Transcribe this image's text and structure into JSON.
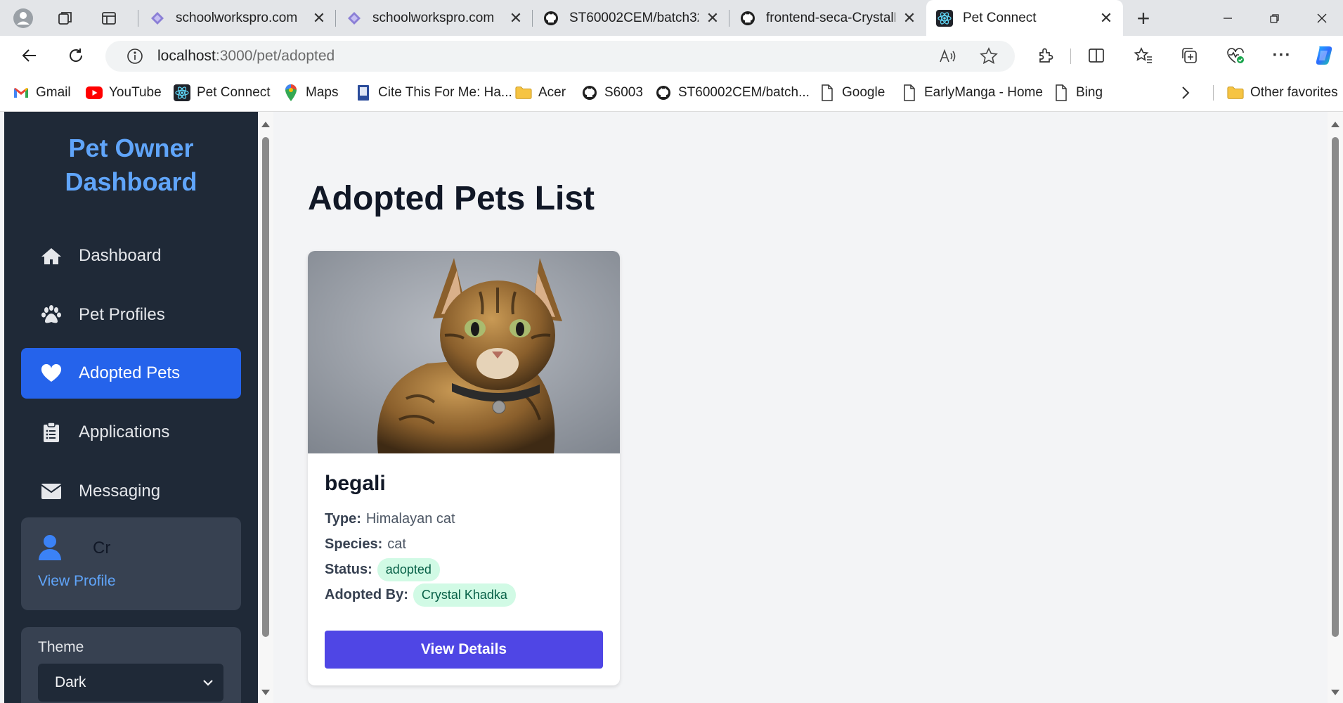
{
  "browser": {
    "tabs": [
      {
        "title": "schoolworkspro.com",
        "favicon": "schoolworkspro-icon",
        "active": false
      },
      {
        "title": "schoolworkspro.com",
        "favicon": "schoolworkspro-icon",
        "active": false
      },
      {
        "title": "ST60002CEM/batch32a",
        "favicon": "github-icon",
        "active": false
      },
      {
        "title": "frontend-seca-CrystalK",
        "favicon": "github-icon",
        "active": false
      },
      {
        "title": "Pet Connect",
        "favicon": "react-icon",
        "active": true
      }
    ],
    "address": {
      "host": "localhost",
      "path": ":3000/pet/adopted"
    },
    "bookmarks": [
      {
        "label": "Gmail",
        "icon": "gmail-icon"
      },
      {
        "label": "YouTube",
        "icon": "youtube-icon"
      },
      {
        "label": "Pet Connect",
        "icon": "react-icon"
      },
      {
        "label": "Maps",
        "icon": "maps-icon"
      },
      {
        "label": "Cite This For Me: Ha...",
        "icon": "book-icon"
      },
      {
        "label": "Acer",
        "icon": "folder-icon"
      },
      {
        "label": "S6003",
        "icon": "github-icon"
      },
      {
        "label": "ST60002CEM/batch...",
        "icon": "github-icon"
      },
      {
        "label": "Google",
        "icon": "page-icon"
      },
      {
        "label": "EarlyManga - Home",
        "icon": "page-icon"
      },
      {
        "label": "Bing",
        "icon": "page-icon"
      }
    ],
    "other_favorites": "Other favorites"
  },
  "sidebar": {
    "brand_line1": "Pet Owner",
    "brand_line2": "Dashboard",
    "items": [
      {
        "label": "Dashboard",
        "icon": "home-icon",
        "active": false
      },
      {
        "label": "Pet Profiles",
        "icon": "paw-icon",
        "active": false
      },
      {
        "label": "Adopted Pets",
        "icon": "heart-icon",
        "active": true
      },
      {
        "label": "Applications",
        "icon": "clipboard-icon",
        "active": false
      },
      {
        "label": "Messaging",
        "icon": "envelope-icon",
        "active": false
      }
    ],
    "user": {
      "name": "Cr",
      "view_profile": "View Profile"
    },
    "theme": {
      "label": "Theme",
      "selected": "Dark"
    }
  },
  "main": {
    "title": "Adopted Pets List",
    "pet": {
      "name": "begali",
      "type_label": "Type:",
      "type_value": "Himalayan cat",
      "species_label": "Species:",
      "species_value": "cat",
      "status_label": "Status:",
      "status_value": "adopted",
      "adopted_by_label": "Adopted By:",
      "adopted_by_value": "Crystal Khadka",
      "button": "View Details"
    }
  },
  "colors": {
    "sidebar_bg": "#1f2937",
    "accent": "#2563eb",
    "brand_text": "#60a5fa",
    "button": "#4f46e5",
    "status_pill": "#d1fae5"
  }
}
